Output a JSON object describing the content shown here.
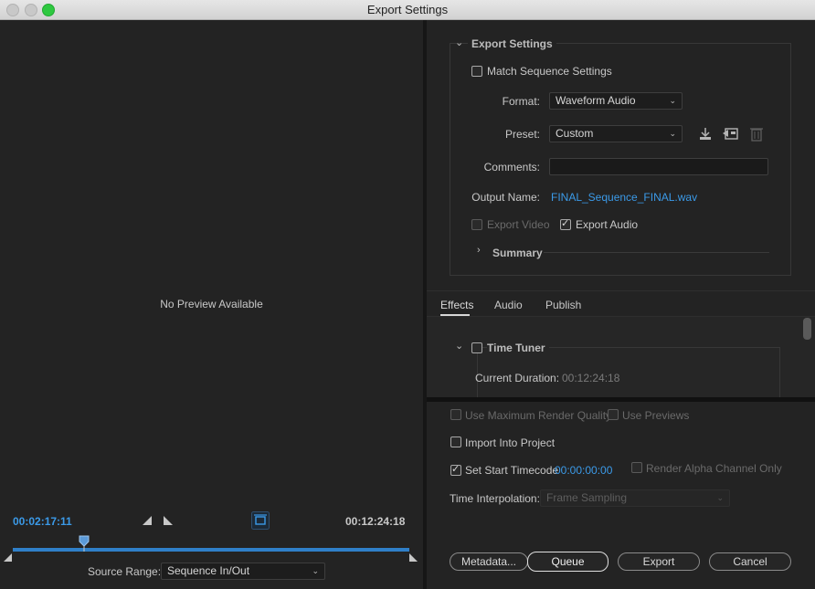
{
  "window": {
    "title": "Export Settings"
  },
  "preview": {
    "message": "No Preview Available",
    "current_time": "00:02:17:11",
    "end_time": "00:12:24:18",
    "source_range_label": "Source Range:",
    "source_range_value": "Sequence In/Out",
    "playhead_fraction": 0.18
  },
  "export_settings": {
    "header": "Export Settings",
    "match_sequence": {
      "label": "Match Sequence Settings",
      "checked": false
    },
    "format": {
      "label": "Format:",
      "value": "Waveform Audio"
    },
    "preset": {
      "label": "Preset:",
      "value": "Custom"
    },
    "comments": {
      "label": "Comments:",
      "value": ""
    },
    "output_name": {
      "label": "Output Name:",
      "value": "FINAL_Sequence_FINAL.wav"
    },
    "export_video": {
      "label": "Export Video",
      "checked": false,
      "enabled": false
    },
    "export_audio": {
      "label": "Export Audio",
      "checked": true
    },
    "summary_label": "Summary"
  },
  "tabs": [
    {
      "label": "Effects",
      "active": true
    },
    {
      "label": "Audio",
      "active": false
    },
    {
      "label": "Publish",
      "active": false
    }
  ],
  "effects": {
    "time_tuner": {
      "label": "Time Tuner",
      "checked": false
    },
    "current_duration_label": "Current Duration:",
    "current_duration_value": "00:12:24:18"
  },
  "options": {
    "max_render_quality": "Use Maximum Render Quality",
    "use_previews": "Use Previews",
    "import_into_project": "Import Into Project",
    "set_start_timecode": "Set Start Timecode",
    "start_timecode_value": "00:00:00:00",
    "render_alpha_only": "Render Alpha Channel Only",
    "time_interpolation_label": "Time Interpolation:",
    "time_interpolation_value": "Frame Sampling"
  },
  "buttons": {
    "metadata": "Metadata...",
    "queue": "Queue",
    "export": "Export",
    "cancel": "Cancel"
  },
  "colors": {
    "accent": "#3b9ae8",
    "timeline": "#2f7fc8"
  },
  "icons": [
    "save-preset-icon",
    "import-preset-icon",
    "delete-preset-icon",
    "mark-in-icon",
    "mark-out-icon",
    "aspect-icon",
    "playhead-icon"
  ]
}
